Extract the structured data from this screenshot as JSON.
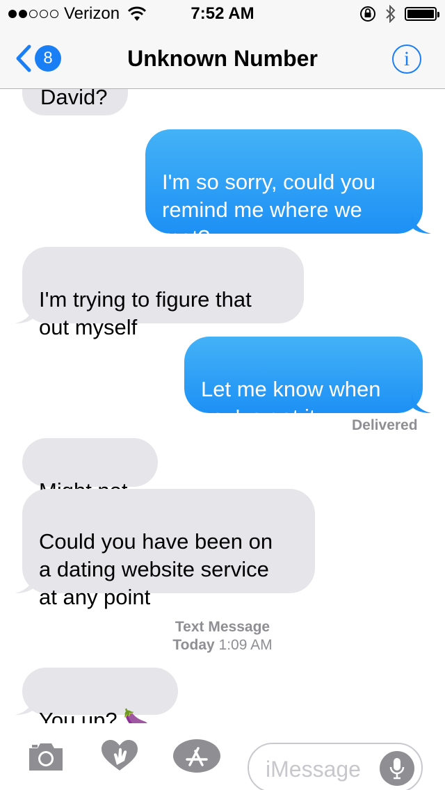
{
  "status_bar": {
    "carrier": "Verizon",
    "signal_bars_filled": 2,
    "signal_bars_total": 5,
    "time": "7:52 AM",
    "battery_level": 1.0
  },
  "nav": {
    "back_count": "8",
    "title": "Unknown Number",
    "info_label": "i"
  },
  "messages": [
    {
      "type": "received",
      "text": "David?"
    },
    {
      "type": "sent",
      "text": "I'm so sorry, could you\nremind me where we\nmet?"
    },
    {
      "type": "received",
      "text": "I'm trying to figure that\nout myself"
    },
    {
      "type": "sent",
      "text": "Let me know when\nyou've got it."
    },
    {
      "type": "status",
      "text": "Delivered"
    },
    {
      "type": "received",
      "text": "Might not"
    },
    {
      "type": "received",
      "text": "Could you have been on\na dating website service\nat any point"
    },
    {
      "type": "received",
      "text": "You up? 🍆"
    }
  ],
  "timestamp": {
    "service": "Text Message",
    "day": "Today",
    "time": "1:09 AM"
  },
  "input_bar": {
    "placeholder": "iMessage"
  },
  "colors": {
    "accent": "#1a7ef5",
    "sent_bubble": "#2a9cf5",
    "received_bubble": "#e5e5ea",
    "meta_text": "#8e8e93"
  }
}
